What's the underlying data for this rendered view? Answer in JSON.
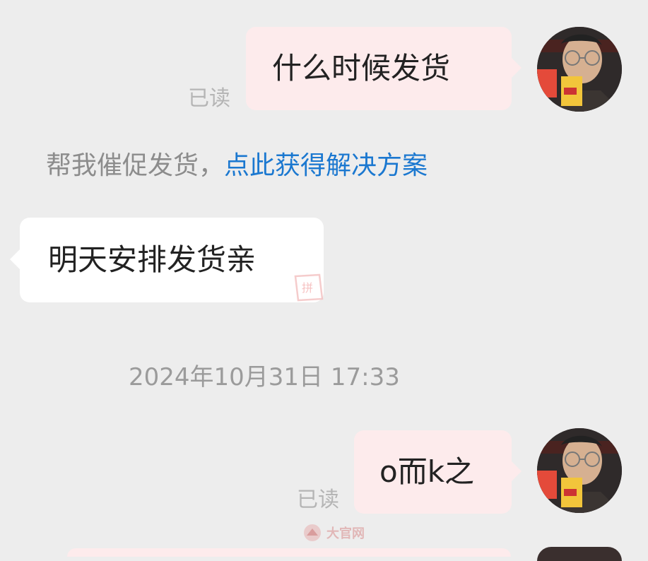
{
  "messages": {
    "m1": {
      "text": "什么时候发货",
      "read_status": "已读"
    },
    "system_tip": {
      "prefix": "帮我催促发货，",
      "link": "点此获得解决方案"
    },
    "m2": {
      "text": "明天安排发货亲",
      "stamp": "拼"
    },
    "timestamp": "2024年10月31日 17:33",
    "m3": {
      "text": "o而k之",
      "read_status": "已读"
    }
  },
  "watermark": {
    "text": "大官网"
  },
  "colors": {
    "background": "#ededed",
    "outgoing_bubble": "#fdebec",
    "incoming_bubble": "#ffffff",
    "link": "#1b78d0",
    "muted_text": "#8c8c8c"
  },
  "icons": {
    "avatar": "user-avatar-photo",
    "stamp": "pinduoduo-stamp-icon",
    "watermark": "watermark-logo-icon"
  }
}
